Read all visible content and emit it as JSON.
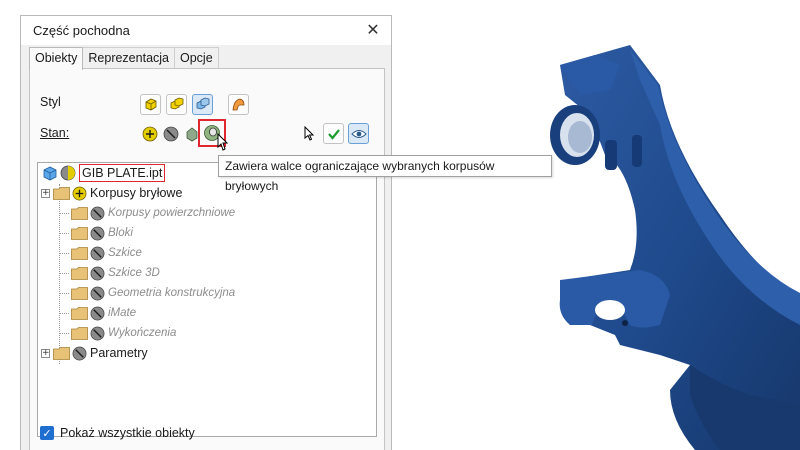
{
  "dialog": {
    "title": "Część pochodna",
    "close_symbol": "✕",
    "tabs": [
      {
        "label": "Obiekty",
        "active": true
      },
      {
        "label": "Reprezentacja",
        "active": false
      },
      {
        "label": "Opcje",
        "active": false
      }
    ],
    "style_label": "Styl",
    "state_label": "Stan:",
    "tooltip": "Zawiera walce ograniczające wybranych korpusów bryłowych",
    "tree": {
      "root": "GIB PLATE.ipt",
      "items": [
        {
          "label": "Korpusy bryłowe",
          "state": "include",
          "expandable": true,
          "dim": false
        },
        {
          "label": "Korpusy powierzchniowe",
          "state": "exclude",
          "expandable": false,
          "dim": true
        },
        {
          "label": "Bloki",
          "state": "exclude",
          "expandable": false,
          "dim": true
        },
        {
          "label": "Szkice",
          "state": "exclude",
          "expandable": false,
          "dim": true
        },
        {
          "label": "Szkice 3D",
          "state": "exclude",
          "expandable": false,
          "dim": true
        },
        {
          "label": "Geometria konstrukcyjna",
          "state": "exclude",
          "expandable": false,
          "dim": true
        },
        {
          "label": "iMate",
          "state": "exclude",
          "expandable": false,
          "dim": true
        },
        {
          "label": "Wykończenia",
          "state": "exclude",
          "expandable": false,
          "dim": true
        },
        {
          "label": "Parametry",
          "state": "exclude",
          "expandable": true,
          "dim": false
        }
      ]
    },
    "show_all": {
      "label": "Pokaż wszystkie obiekty",
      "checked": true
    }
  },
  "colors": {
    "highlight": "#e0262e",
    "include": "#d8c200",
    "exclude": "#808080",
    "model": "#1f4a8c",
    "folder": "#e8c277"
  }
}
